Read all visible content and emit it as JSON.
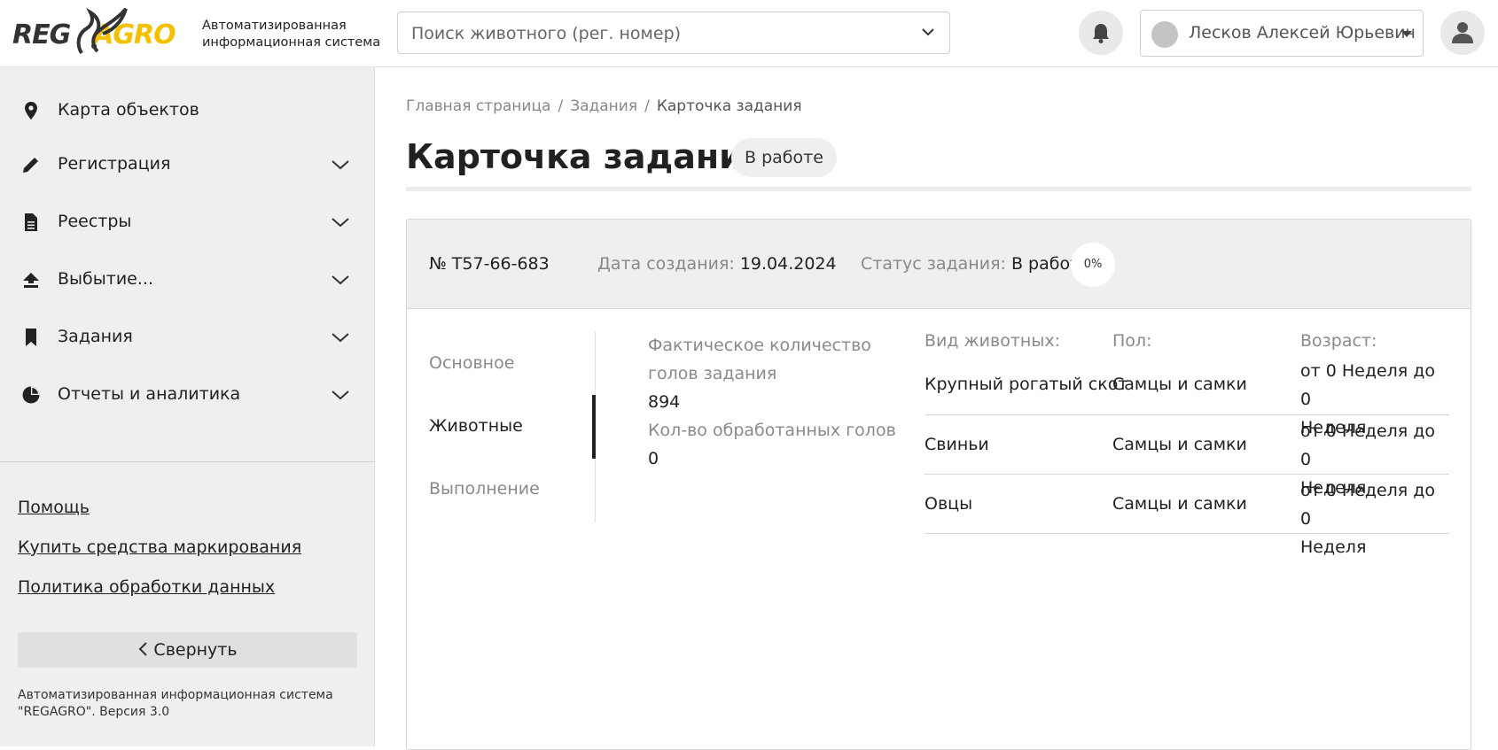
{
  "header": {
    "logo": {
      "left": "REG",
      "right": "AGRO"
    },
    "app_subtitle_line1": "Автоматизированная",
    "app_subtitle_line2": "информационная система",
    "search": {
      "placeholder": "Поиск животного (рег. номер)"
    },
    "user": {
      "name": "Лесков Алексей Юрьевич"
    }
  },
  "sidebar": {
    "items": [
      {
        "label": "Карта объектов",
        "icon": "map-marker-icon",
        "expandable": false
      },
      {
        "label": "Регистрация",
        "icon": "pencil-icon",
        "expandable": true
      },
      {
        "label": "Реестры",
        "icon": "document-icon",
        "expandable": true
      },
      {
        "label": "Выбытие...",
        "icon": "upload-arrow-icon",
        "expandable": true
      },
      {
        "label": "Задания",
        "icon": "bookmark-icon",
        "expandable": true
      },
      {
        "label": "Отчеты и аналитика",
        "icon": "pie-chart-icon",
        "expandable": true
      }
    ],
    "links": [
      "Помощь",
      "Купить средства маркирования",
      "Политика обработки данных"
    ],
    "collapse_label": "Свернуть",
    "footer_line1": "Автоматизированная информационная система",
    "footer_line2": "\"REGAGRO\". Версия 3.0"
  },
  "breadcrumb": {
    "home": "Главная страница",
    "tasks": "Задания",
    "current": "Карточка задания"
  },
  "page": {
    "title": "Карточка задания",
    "status": "В работе"
  },
  "card": {
    "number": "№ T57-66-683",
    "date_label": "Дата создания:",
    "date_value": "19.04.2024",
    "status_label": "Статус задания:",
    "status_value": "В работе",
    "progress": "0%"
  },
  "tabs": [
    {
      "label": "Основное",
      "active": false
    },
    {
      "label": "Животные",
      "active": true
    },
    {
      "label": "Выполнение",
      "active": false
    }
  ],
  "stats": {
    "actual_label_line1": "Фактическое количество",
    "actual_label_line2": "голов задания",
    "actual_value": "894",
    "processed_label": "Кол-во обработанных голов",
    "processed_value": "0"
  },
  "animals_table": {
    "headers": [
      "Вид животных:",
      "Пол:",
      "Возраст:"
    ],
    "rows": [
      {
        "species": "Крупный рогатый скот",
        "sex": "Самцы и самки",
        "age_line1": "от 0 Неделя до 0",
        "age_line2": "Неделя"
      },
      {
        "species": "Свиньи",
        "sex": "Самцы и самки",
        "age_line1": "от 0 Неделя до 0",
        "age_line2": "Неделя"
      },
      {
        "species": "Овцы",
        "sex": "Самцы и самки",
        "age_line1": "от 0 Неделя до 0",
        "age_line2": "Неделя"
      }
    ]
  }
}
